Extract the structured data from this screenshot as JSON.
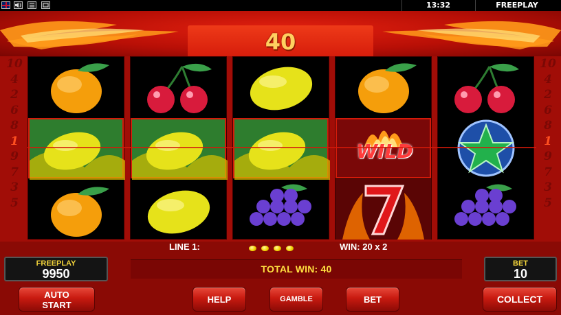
{
  "topbar": {
    "time": "13:32",
    "mode": "FREEPLAY"
  },
  "header": {
    "win_amount": "40"
  },
  "lines_left": [
    "10",
    "4",
    "2",
    "6",
    "8",
    "1",
    "9",
    "7",
    "3",
    "5"
  ],
  "lines_right": [
    "10",
    "4",
    "2",
    "6",
    "8",
    "1",
    "9",
    "7",
    "3",
    "5"
  ],
  "reels": [
    [
      "orange",
      "lemon",
      "orange"
    ],
    [
      "cherries",
      "lemon",
      "lemon"
    ],
    [
      "lemon",
      "lemon",
      "grapes"
    ],
    [
      "orange",
      "wild",
      "seven"
    ],
    [
      "cherries",
      "star",
      "grapes"
    ]
  ],
  "info": {
    "line_label": "LINE 1:",
    "win_label": "WIN: 20 x 2"
  },
  "total_win": "TOTAL WIN: 40",
  "balance": {
    "label": "FREEPLAY",
    "value": "9950"
  },
  "bet": {
    "label": "BET",
    "value": "10"
  },
  "wild_text": "WILD",
  "buttons": {
    "auto_start_1": "AUTO",
    "auto_start_2": "START",
    "help": "HELP",
    "gamble": "GAMBLE",
    "bet": "BET",
    "collect": "COLLECT"
  }
}
